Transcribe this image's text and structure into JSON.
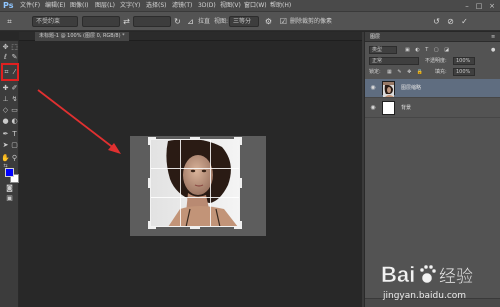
{
  "app": {
    "logo": "Ps",
    "menu": [
      "文件(F)",
      "编辑(E)",
      "图像(I)",
      "图层(L)",
      "文字(Y)",
      "选择(S)",
      "滤镜(T)",
      "3D(D)",
      "视图(V)",
      "窗口(W)",
      "帮助(H)"
    ],
    "window_buttons": [
      "–",
      "□",
      "×"
    ]
  },
  "options": {
    "ratio_select": "不受约束",
    "straighten_label": "拉直",
    "view_label": "视图:",
    "view_value": "三等分",
    "delete_cropped_label": "删除裁剪的像素",
    "delete_cropped_checked": true
  },
  "document": {
    "tab_title": "未标题-1 @ 100% (图层 0, RGB/8) *"
  },
  "layers_panel": {
    "title": "图层",
    "kind_filter": "类型",
    "blend_mode": "正常",
    "opacity_label": "不透明度:",
    "opacity_value": "100%",
    "fill_label": "填充:",
    "fill_value": "100%",
    "lock_label": "锁定:",
    "layers": [
      {
        "name": "图层缩略",
        "selected": true,
        "visible": true
      },
      {
        "name": "背景",
        "selected": false,
        "visible": true
      }
    ]
  },
  "colors": {
    "foreground": "#0000ff",
    "background": "#ffffff",
    "highlight_box": "#e02020",
    "arrow": "#e03030"
  },
  "watermark": {
    "brand": "Bai 经验",
    "url": "jingyan.baidu.com"
  }
}
